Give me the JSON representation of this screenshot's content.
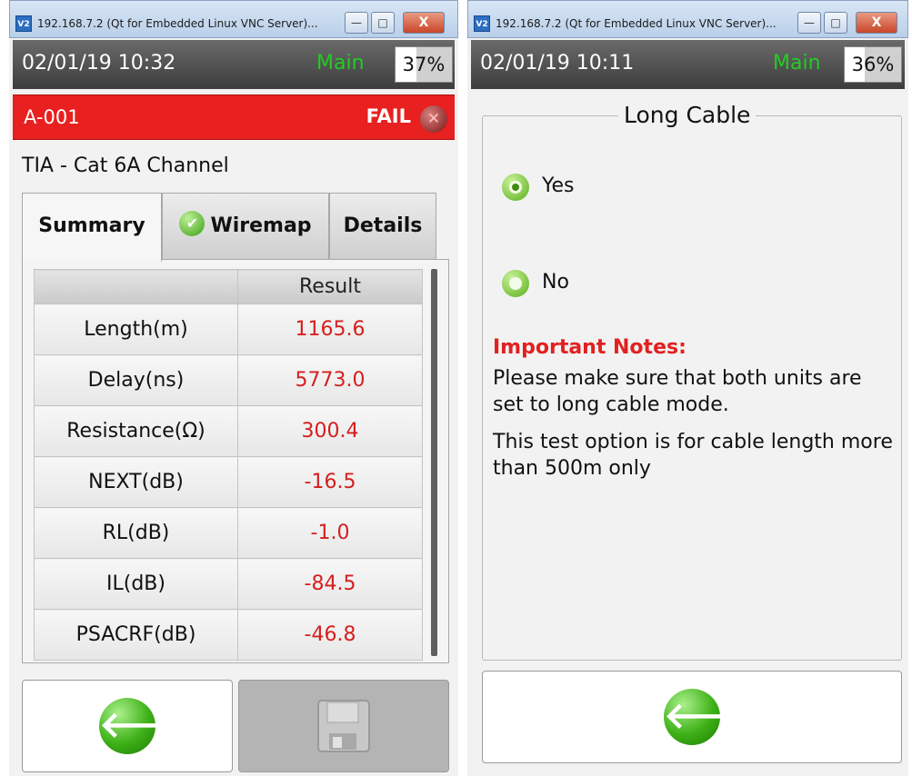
{
  "windows": [
    {
      "title": "192.168.7.2 (Qt for Embedded Linux VNC Server)...",
      "app_icon": "V2",
      "controls": {
        "minimize": "—",
        "maximize": "□",
        "close": "X"
      },
      "status": {
        "datetime": "02/01/19 10:32",
        "mode": "Main",
        "battery": "37%",
        "battery_fraction": 0.37
      },
      "result_bar": {
        "test_id": "A-001",
        "result": "FAIL",
        "icon": "fail-x-icon",
        "color": "#e8201f"
      },
      "cable_type": "TIA - Cat 6A Channel",
      "tabs": [
        {
          "label": "Summary",
          "active": true
        },
        {
          "label": "Wiremap",
          "active": false,
          "icon": "check-icon"
        },
        {
          "label": "Details",
          "active": false
        }
      ],
      "table": {
        "header": [
          "",
          "Result"
        ],
        "rows": [
          {
            "label": "Length(m)",
            "value": "1165.6"
          },
          {
            "label": "Delay(ns)",
            "value": "5773.0"
          },
          {
            "label": "Resistance(Ω)",
            "value": "300.4"
          },
          {
            "label": "NEXT(dB)",
            "value": "-16.5"
          },
          {
            "label": "RL(dB)",
            "value": "-1.0"
          },
          {
            "label": "IL(dB)",
            "value": "-84.5"
          },
          {
            "label": "PSACRF(dB)",
            "value": "-46.8"
          }
        ],
        "fail_color": "#d51f1f"
      },
      "buttons": {
        "back_icon": "back-arrow-icon",
        "save_icon": "floppy-disk-icon",
        "save_enabled": false
      }
    },
    {
      "title": "192.168.7.2 (Qt for Embedded Linux VNC Server)...",
      "app_icon": "V2",
      "controls": {
        "minimize": "—",
        "maximize": "□",
        "close": "X"
      },
      "status": {
        "datetime": "02/01/19 10:11",
        "mode": "Main",
        "battery": "36%",
        "battery_fraction": 0.36
      },
      "group_title": "Long Cable",
      "options": [
        {
          "label": "Yes",
          "selected": true
        },
        {
          "label": "No",
          "selected": false
        }
      ],
      "notes_title": "Important Notes:",
      "notes": [
        "Please make sure that both units are set to long cable mode.",
        "This test option is for cable length more than 500m only"
      ],
      "buttons": {
        "back_icon": "back-arrow-icon"
      }
    }
  ]
}
